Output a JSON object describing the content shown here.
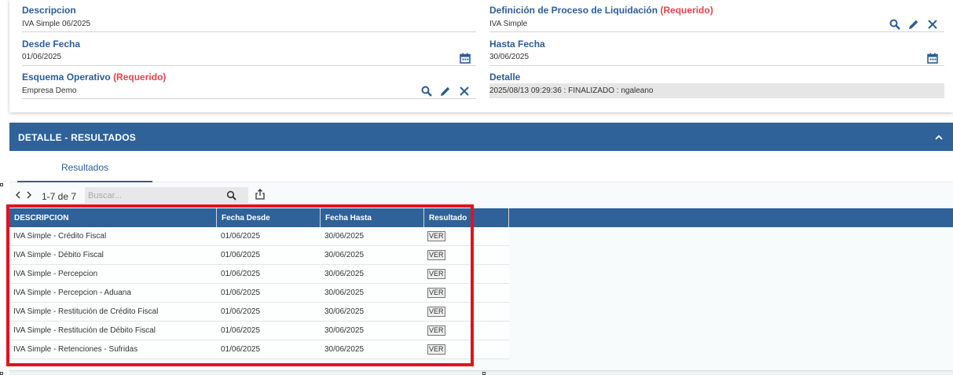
{
  "form": {
    "descripcion": {
      "label": "Descripcion",
      "value": "IVA Simple 06/2025"
    },
    "definicion": {
      "label": "Definición de Proceso de Liquidación",
      "required": "(Requerido)",
      "value": "IVA Simple"
    },
    "desde": {
      "label": "Desde Fecha",
      "value": "01/06/2025"
    },
    "hasta": {
      "label": "Hasta Fecha",
      "value": "30/06/2025"
    },
    "esquema": {
      "label": "Esquema Operativo",
      "required": "(Requerido)",
      "value": "Empresa Demo"
    },
    "detalle": {
      "label": "Detalle",
      "value": "2025/08/13 09:29:36 : FINALIZADO : ngaleano"
    }
  },
  "section": {
    "title": "DETALLE - RESULTADOS"
  },
  "tabs": [
    {
      "label": "Resultados"
    }
  ],
  "toolbar": {
    "pager": "1-7 de 7",
    "search_placeholder": "Buscar..."
  },
  "grid": {
    "columns": [
      "DESCRIPCION",
      "Fecha Desde",
      "Fecha Hasta",
      "Resultado"
    ],
    "rows": [
      {
        "descripcion": "IVA Simple - Crédito Fiscal",
        "desde": "01/06/2025",
        "hasta": "30/06/2025",
        "resultado": "VER"
      },
      {
        "descripcion": "IVA Simple - Débito Fiscal",
        "desde": "01/06/2025",
        "hasta": "30/06/2025",
        "resultado": "VER"
      },
      {
        "descripcion": "IVA Simple - Percepcion",
        "desde": "01/06/2025",
        "hasta": "30/06/2025",
        "resultado": "VER"
      },
      {
        "descripcion": "IVA Simple - Percepcion - Aduana",
        "desde": "01/06/2025",
        "hasta": "30/06/2025",
        "resultado": "VER"
      },
      {
        "descripcion": "IVA Simple - Restitución de Crédito Fiscal",
        "desde": "01/06/2025",
        "hasta": "30/06/2025",
        "resultado": "VER"
      },
      {
        "descripcion": "IVA Simple - Restitución de Débito Fiscal",
        "desde": "01/06/2025",
        "hasta": "30/06/2025",
        "resultado": "VER"
      },
      {
        "descripcion": "IVA Simple - Retenciones - Sufridas",
        "desde": "01/06/2025",
        "hasta": "30/06/2025",
        "resultado": "VER"
      }
    ]
  },
  "colors": {
    "header_blue": "#2e6298",
    "label_blue": "#2c5d97",
    "required_red": "#e0454a",
    "highlight_red": "#e0141e"
  }
}
